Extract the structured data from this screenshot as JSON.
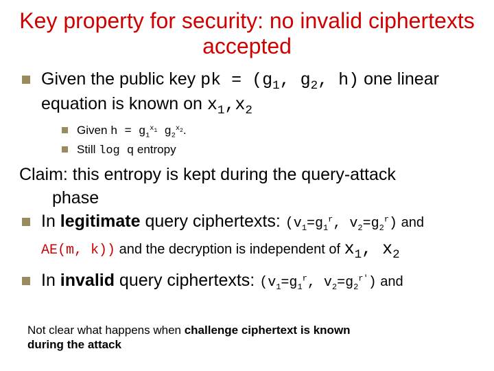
{
  "title": "Key property for security: no invalid ciphertexts accepted",
  "b1": {
    "pre": "Given the public key ",
    "pk": "pk = (g",
    "g1sub": "1",
    "comma1": ", g",
    "g2sub": "2",
    "comma2": ", h)",
    "post1": " one linear equation is known on ",
    "x": "x",
    "x1sub": "1",
    "sep": ",",
    "x2": "x",
    "x2sub": "2"
  },
  "b1a": {
    "pre": "Given  ",
    "h": "h = g",
    "s1": "1",
    "e1": "x",
    "e1s": "1",
    "mid": " g",
    "s2": "2",
    "e2": "x",
    "e2s": "2",
    "end": "."
  },
  "b1b": {
    "pre": "Still ",
    "logq": "log q",
    "post": " entropy"
  },
  "claim1": "Claim: this entropy is kept during the query-attack",
  "claim1b": "phase",
  "b2": {
    "pre": "In ",
    "leg": "legitimate",
    "mid": " query ciphertexts: ",
    "paren": "(v",
    "v1s": "1",
    "eq1": "=g",
    "g1s": "1",
    "r1": "r",
    "c": ", v",
    "v2s": "2",
    "eq2": "=g",
    "g2s": "2",
    "r2": "r",
    "close": ")",
    "and": " and"
  },
  "b2tail": {
    "ae": "AE(m, k))",
    "mid": " and the decryption is independent of ",
    "x1": "x",
    "x1s": "1",
    "sep": ", ",
    "x2": "x",
    "x2s": "2"
  },
  "b3": {
    "pre": "In ",
    "inv": "invalid",
    "mid": " query ciphertexts: ",
    "paren": "(v",
    "v1s": "1",
    "eq1": "=g",
    "g1s": "1",
    "r1": "r",
    "c": ", v",
    "v2s": "2",
    "eq2": "=g",
    "g2s": "2",
    "r2": "r'",
    "close": ")",
    "and": " and"
  },
  "foot": {
    "l1a": "Not clear what happens when ",
    "l1b": "challenge ciphertext is known",
    "l2": "during the attack"
  }
}
